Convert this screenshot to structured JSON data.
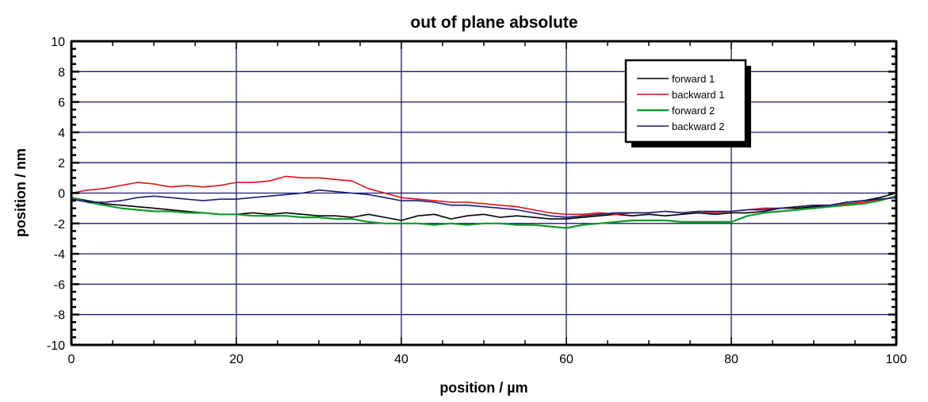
{
  "chart_data": {
    "type": "line",
    "title": "out of plane absolute",
    "xlabel": "position  / µm",
    "ylabel": "position  / nm",
    "xlim": [
      0,
      100
    ],
    "ylim": [
      -10,
      10
    ],
    "x_ticks": [
      0,
      20,
      40,
      60,
      80,
      100
    ],
    "x_tick_labels": [
      "0",
      "20",
      "40",
      "60",
      "80",
      "100"
    ],
    "y_ticks": [
      -10,
      -8,
      -6,
      -4,
      -2,
      0,
      2,
      4,
      6,
      8,
      10
    ],
    "y_tick_labels": [
      "-10",
      "-8",
      "-6",
      "-4",
      "-2",
      "0",
      "2",
      "4",
      "6",
      "8",
      "10"
    ],
    "x_minor_step": 5,
    "y_minor_step": 0.5,
    "grid": true,
    "grid_color": "#1a1a6e",
    "legend_position": "top-right",
    "x": [
      0,
      2,
      4,
      6,
      8,
      10,
      12,
      14,
      16,
      18,
      20,
      22,
      24,
      26,
      28,
      30,
      32,
      34,
      36,
      38,
      40,
      42,
      44,
      46,
      48,
      50,
      52,
      54,
      56,
      58,
      60,
      62,
      64,
      66,
      68,
      70,
      72,
      74,
      76,
      78,
      80,
      82,
      84,
      86,
      88,
      90,
      92,
      94,
      96,
      98,
      100
    ],
    "series": [
      {
        "name": "forward 1",
        "color": "#000000",
        "values": [
          -0.3,
          -0.5,
          -0.7,
          -0.8,
          -0.9,
          -1.0,
          -1.1,
          -1.2,
          -1.3,
          -1.4,
          -1.4,
          -1.3,
          -1.4,
          -1.3,
          -1.4,
          -1.5,
          -1.5,
          -1.6,
          -1.4,
          -1.6,
          -1.8,
          -1.5,
          -1.4,
          -1.7,
          -1.5,
          -1.4,
          -1.6,
          -1.5,
          -1.6,
          -1.7,
          -1.7,
          -1.6,
          -1.5,
          -1.4,
          -1.5,
          -1.4,
          -1.5,
          -1.4,
          -1.3,
          -1.4,
          -1.3,
          -1.3,
          -1.2,
          -1.0,
          -1.0,
          -0.9,
          -0.8,
          -0.6,
          -0.5,
          -0.3,
          0.0
        ]
      },
      {
        "name": "backward 1",
        "color": "#e01010",
        "values": [
          0.0,
          0.2,
          0.3,
          0.5,
          0.7,
          0.6,
          0.4,
          0.5,
          0.4,
          0.5,
          0.7,
          0.7,
          0.8,
          1.1,
          1.0,
          1.0,
          0.9,
          0.8,
          0.3,
          0.0,
          -0.3,
          -0.4,
          -0.5,
          -0.6,
          -0.6,
          -0.7,
          -0.8,
          -0.9,
          -1.1,
          -1.3,
          -1.4,
          -1.4,
          -1.3,
          -1.4,
          -1.3,
          -1.3,
          -1.2,
          -1.3,
          -1.2,
          -1.3,
          -1.2,
          -1.1,
          -1.0,
          -1.0,
          -0.9,
          -0.8,
          -0.8,
          -0.7,
          -0.6,
          -0.4,
          -0.3
        ]
      },
      {
        "name": "forward 2",
        "color": "#119a2a",
        "values": [
          -0.3,
          -0.6,
          -0.8,
          -1.0,
          -1.1,
          -1.2,
          -1.2,
          -1.3,
          -1.3,
          -1.4,
          -1.4,
          -1.5,
          -1.5,
          -1.5,
          -1.6,
          -1.6,
          -1.7,
          -1.7,
          -1.9,
          -2.0,
          -2.0,
          -2.0,
          -2.1,
          -2.0,
          -2.1,
          -2.0,
          -2.0,
          -2.1,
          -2.1,
          -2.2,
          -2.3,
          -2.1,
          -2.0,
          -1.9,
          -1.8,
          -1.8,
          -1.8,
          -1.9,
          -1.9,
          -1.9,
          -1.9,
          -1.5,
          -1.3,
          -1.2,
          -1.1,
          -1.0,
          -0.9,
          -0.8,
          -0.7,
          -0.5,
          -0.2
        ]
      },
      {
        "name": "backward 2",
        "color": "#1c1c78",
        "values": [
          -0.4,
          -0.6,
          -0.6,
          -0.5,
          -0.3,
          -0.2,
          -0.3,
          -0.4,
          -0.5,
          -0.4,
          -0.4,
          -0.3,
          -0.2,
          -0.1,
          0.0,
          0.2,
          0.1,
          0.0,
          -0.1,
          -0.3,
          -0.5,
          -0.5,
          -0.6,
          -0.8,
          -0.8,
          -0.9,
          -1.0,
          -1.1,
          -1.3,
          -1.5,
          -1.6,
          -1.5,
          -1.4,
          -1.3,
          -1.3,
          -1.3,
          -1.2,
          -1.3,
          -1.2,
          -1.2,
          -1.2,
          -1.1,
          -1.1,
          -1.0,
          -0.9,
          -0.8,
          -0.8,
          -0.6,
          -0.5,
          -0.4,
          -0.3
        ]
      }
    ]
  }
}
